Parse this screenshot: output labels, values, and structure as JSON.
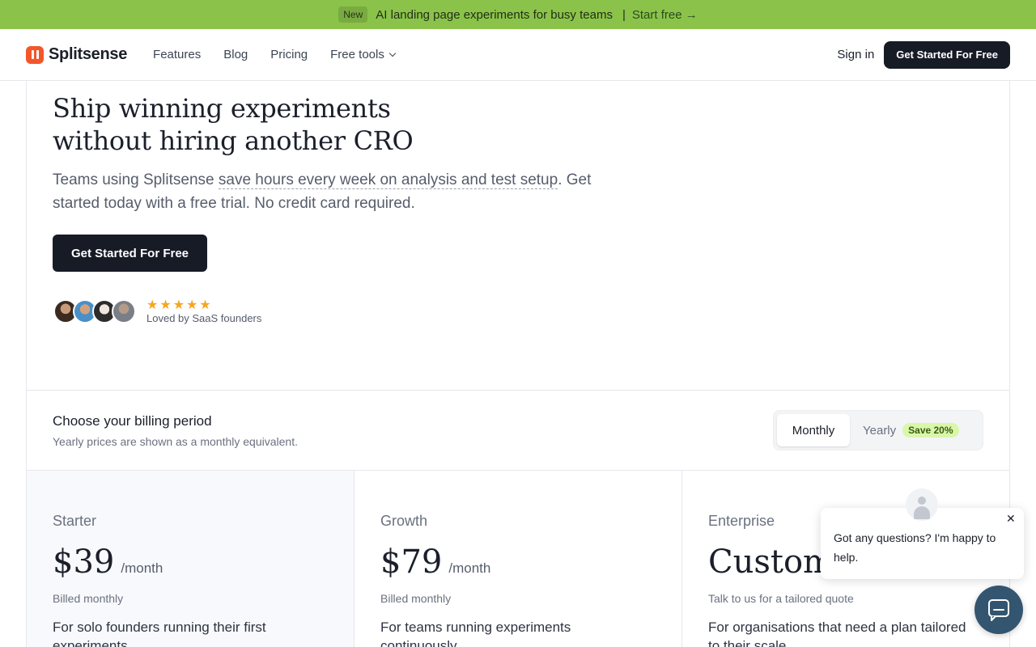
{
  "announcement": {
    "badge": "New",
    "message": "AI landing page experiments for busy teams",
    "separator": "|",
    "cta": "Start free →"
  },
  "header": {
    "brand": "Splitsense",
    "nav": {
      "features": "Features",
      "blog": "Blog",
      "pricing": "Pricing",
      "free_tools": "Free tools"
    },
    "sign_in": "Sign in",
    "cta": "Get Started For Free"
  },
  "hero": {
    "title_line1": "Ship winning experiments",
    "title_line2": "without hiring another CRO",
    "sub_before": "Teams using Splitsense ",
    "sub_highlight": "save hours every week on analysis and test setup",
    "sub_after": ". Get started today with a free trial. No credit card required.",
    "cta": "Get Started For Free",
    "rating_stars": 5,
    "social_proof": "Loved by SaaS founders"
  },
  "billing": {
    "title": "Choose your billing period",
    "subtitle": "Yearly prices are shown as a monthly equivalent.",
    "monthly": "Monthly",
    "yearly": "Yearly",
    "save_badge": "Save 20%",
    "selected": "Monthly"
  },
  "plans": [
    {
      "name": "Starter",
      "price": "$39",
      "unit": "/month",
      "billed": "Billed monthly",
      "desc": "For solo founders running their first experiments"
    },
    {
      "name": "Growth",
      "price": "$79",
      "unit": "/month",
      "billed": "Billed monthly",
      "desc": "For teams running experiments continuously"
    },
    {
      "name": "Enterprise",
      "price": "Custom",
      "unit": "",
      "billed": "Talk to us for a tailored quote",
      "desc": "For organisations that need a plan tailored to their scale"
    }
  ],
  "chat": {
    "message": "Got any questions? I'm happy to help.",
    "close": "✕"
  },
  "colors": {
    "announce_bg": "#8bc34a",
    "brand": "#f2562b",
    "dark_button": "#171b26",
    "star": "#f5a623",
    "chat_launcher": "#34556f"
  }
}
